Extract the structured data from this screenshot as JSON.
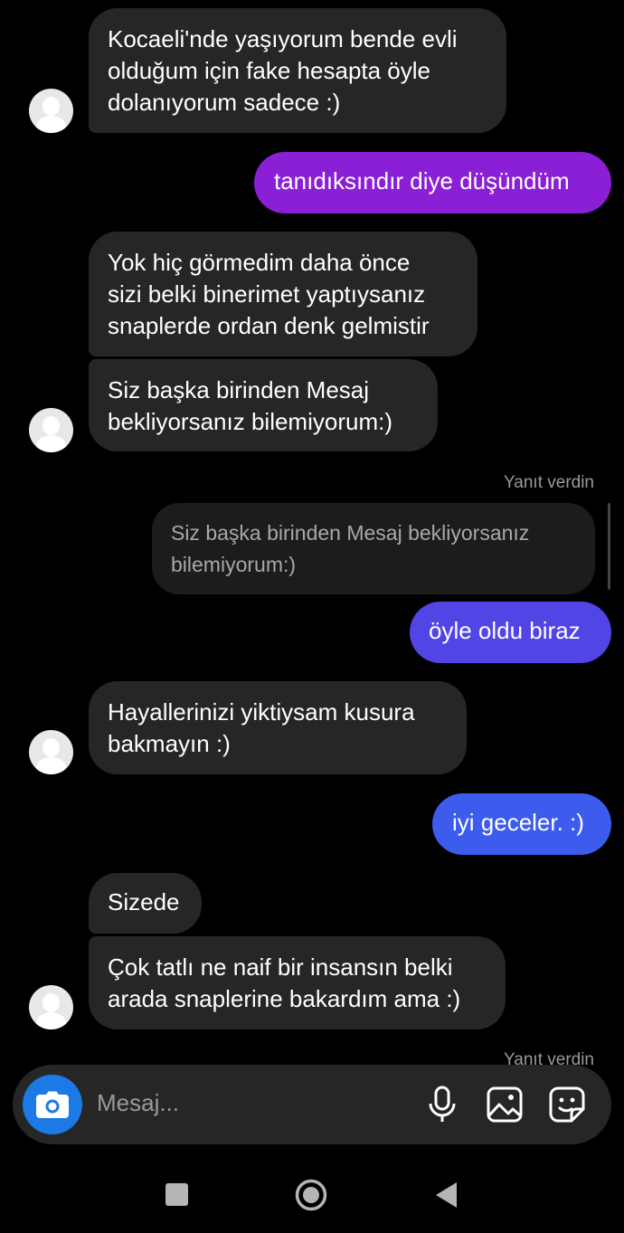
{
  "messages": [
    {
      "id": "m1",
      "direction": "incoming",
      "text": "Kocaeli'nde yaşıyorum bende evli\nolduğum için fake hesapta öyle\ndolanıyorum sadece :)"
    },
    {
      "id": "m2",
      "direction": "outgoing",
      "text": "tanıdıksındır diye düşündüm",
      "color": "#8a1fd6"
    },
    {
      "id": "m3",
      "direction": "incoming",
      "text": "Yok hiç görmedim daha önce\nsizi belki binerimet yaptıysanız\nsnaplerde ordan denk gelmistir"
    },
    {
      "id": "m4",
      "direction": "incoming",
      "text": "Siz başka birinden Mesaj\nbekliyorsanız bilemiyorum:)"
    },
    {
      "id": "m5",
      "direction": "outgoing",
      "reply_label": "Yanıt verdin",
      "quoted_text": "Siz başka birinden Mesaj bekliyorsanız\nbilemiyorum:)",
      "text": "öyle oldu biraz",
      "color": "#5245e5"
    },
    {
      "id": "m6",
      "direction": "incoming",
      "text": "Hayallerinizi yiktiysam kusura\nbakmayın :)"
    },
    {
      "id": "m7",
      "direction": "outgoing",
      "text": "iyi geceler. :)",
      "color": "#3d5cee"
    },
    {
      "id": "m8",
      "direction": "incoming",
      "text": "Sizede"
    },
    {
      "id": "m9",
      "direction": "incoming",
      "text": "Çok tatlı ne naif bir insansın belki\narada snaplerine bakardım ama :)"
    },
    {
      "id": "m10",
      "direction": "outgoing",
      "reply_label": "Yanıt verdin"
    }
  ],
  "composer": {
    "placeholder": "Mesaj...",
    "icons": [
      "camera-icon",
      "microphone-icon",
      "gallery-icon",
      "sticker-icon"
    ],
    "camera_color": "#1b7ae6"
  },
  "navigation": {
    "buttons": [
      "recents-button",
      "home-button",
      "back-button"
    ]
  }
}
